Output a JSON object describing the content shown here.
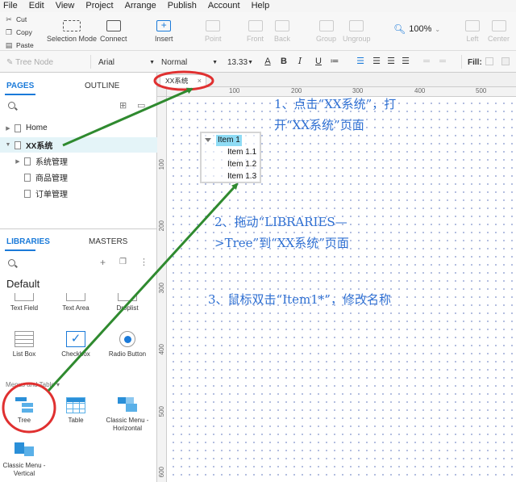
{
  "menu": [
    "File",
    "Edit",
    "View",
    "Project",
    "Arrange",
    "Publish",
    "Account",
    "Help"
  ],
  "toolbar": {
    "cut": "Cut",
    "copy": "Copy",
    "paste": "Paste",
    "selection_mode": "Selection Mode",
    "connect": "Connect",
    "insert": "Insert",
    "point": "Point",
    "front": "Front",
    "back": "Back",
    "group": "Group",
    "ungroup": "Ungroup",
    "zoom": "100%",
    "left": "Left",
    "center": "Center"
  },
  "format": {
    "style": "Tree Node",
    "font": "Arial",
    "weight": "Normal",
    "size": "13.33",
    "fill": "Fill:"
  },
  "pages_panel": {
    "tab_pages": "PAGES",
    "tab_outline": "OUTLINE",
    "pages": [
      {
        "label": "Home",
        "level": 0,
        "caret": "▶"
      },
      {
        "label": "XX系统",
        "level": 0,
        "caret": "▼"
      },
      {
        "label": "系统管理",
        "level": 1,
        "caret": "▶"
      },
      {
        "label": "商品管理",
        "level": 1,
        "caret": ""
      },
      {
        "label": "订单管理",
        "level": 1,
        "caret": ""
      }
    ]
  },
  "libraries_panel": {
    "tab_libraries": "LIBRARIES",
    "tab_masters": "MASTERS",
    "library": "Default",
    "widgets_top": [
      "Text Field",
      "Text Area",
      "Droplist"
    ],
    "widgets_mid": [
      "List Box",
      "Checkbox",
      "Radio Button"
    ],
    "section": "Menus and Table",
    "widgets_menu": [
      "Tree",
      "Table",
      "Classic Menu - Horizontal"
    ],
    "widgets_menu2": [
      "Classic Menu - Vertical"
    ]
  },
  "canvas": {
    "tab": "XX系统",
    "ruler_h": [
      "100",
      "200",
      "300",
      "400",
      "500"
    ],
    "ruler_v": [
      "100",
      "200",
      "300",
      "400",
      "500",
      "600"
    ],
    "tree": {
      "root": "Item 1",
      "children": [
        "Item 1.1",
        "Item 1.2",
        "Item 1.3"
      ]
    }
  },
  "annotations": {
    "step1_line1": "1、点击“XX系统”，打",
    "step1_line2": "开“XX系统”页面",
    "step2_line1": "2、拖动“LIBRARIES—",
    "step2_line2": ">Tree”到“XX系统”页面",
    "step3": "3、鼠标双击“Item1*”，修改名称"
  },
  "colors": {
    "accent": "#1a7ad9",
    "annotation": "#2e6fd2",
    "arrow": "#2f8a2f",
    "highlight": "#e03030",
    "selection": "#8fdcf5"
  }
}
